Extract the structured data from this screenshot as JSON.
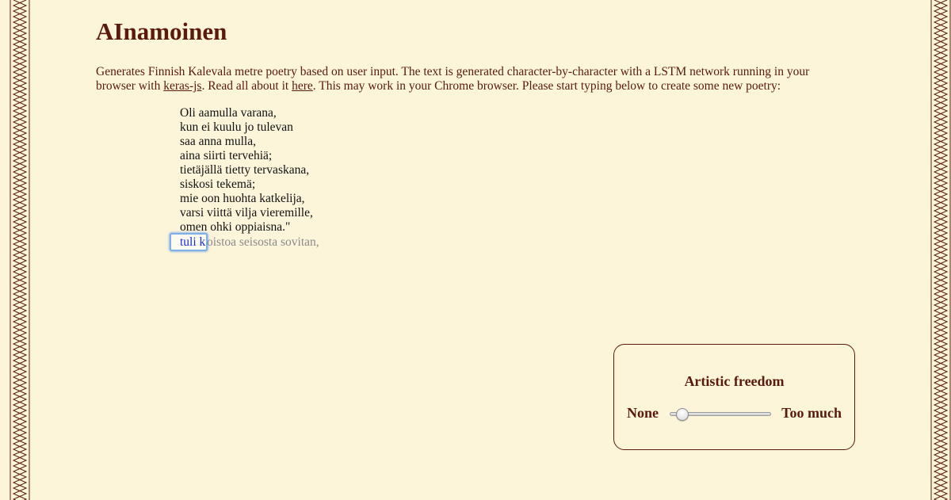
{
  "header": {
    "title": "AInamoinen"
  },
  "intro": {
    "text_before_keras": "Generates Finnish Kalevala metre poetry based on user input. The text is generated character-by-character with a LSTM network running in your browser with ",
    "keras_link": "keras-js",
    "text_between": ". Read all about it ",
    "here_link": "here",
    "text_after": ". This may work in your Chrome browser. Please start typing below to create some new poetry:"
  },
  "poem": {
    "lines": [
      "Oli aamulla varana,",
      "kun ei kuulu jo tulevan",
      "saa anna mulla,",
      "aina siirti tervehiä;",
      "tietäjällä tietty tervaskana,",
      "siskosi tekemä;",
      "mie oon huohta katkelija,",
      "varsi viittä vilja vieremille,",
      "omen ohki oppiaisna.\""
    ],
    "input_value": "tuli k",
    "suggestion": "oistoa seisosta sovitan,"
  },
  "freedom_panel": {
    "title": "Artistic freedom",
    "min_label": "None",
    "max_label": "Too much",
    "slider_value": 0.07
  },
  "colors": {
    "background": "#fcf5d9",
    "text_brown": "#5a1a0c",
    "input_text_blue": "#1a2fd0",
    "suggestion_gray": "#8a8a8a"
  }
}
